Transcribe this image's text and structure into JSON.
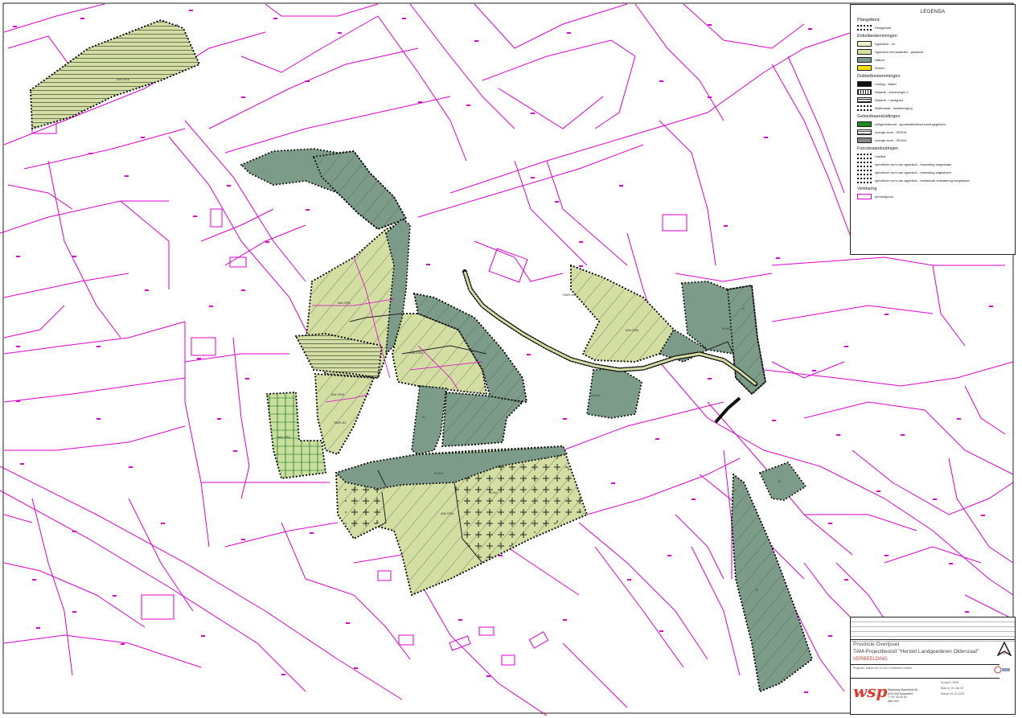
{
  "map": {
    "parcel_color": "#e000d0",
    "agrarisch_color": "#d3dea3",
    "natuur_color": "#7c9b88",
    "labels": {
      "a1": "AW-GRA",
      "a2": "AW-GRA",
      "a3": "AW-GRA",
      "a4": "AW-GRA",
      "a5": "AW-GRA",
      "a6": "AW-GRA",
      "a7": "AW-GRA",
      "r1": "W-AO",
      "r2": "W-AO",
      "r3": "W-AO",
      "r4": "W-AO",
      "r5": "SWR-AO",
      "r6": "SWR-A2",
      "n1": "N",
      "n2": "N",
      "n3": "N",
      "n4": "N"
    }
  },
  "legend": {
    "title": "LEGENDA",
    "plangebied_header": "Plangebied",
    "plangebied": "Plangebied",
    "enkel_header": "Enkelbestemmingen",
    "enkel": [
      "Agrarisch - 1a",
      "Agrarisch met waarden - grasland",
      "Natuur",
      "Wonen"
    ],
    "dubbel_header": "Dubbelbestemmingen",
    "dubbel": [
      "Leiding - Water",
      "Waarde - Archeologie 2",
      "Waarde - Landgoed",
      "Waterstaat - Waterberging"
    ],
    "gebied_header": "Gebiedsaanduidingen",
    "gebied": [
      "veiligheidszone - grondwaterbeschermingsgebied",
      "overige zone - IPZ076",
      "overige zone - IPZ024"
    ],
    "functie_header": "Functieaanduidingen",
    "functie": [
      "Voetbal",
      "specifieke vorm van agrarisch - beweiding toegestaan",
      "specifieke vorm van agrarisch - beweiding uitgesloten",
      "specifieke vorm van agrarisch - bestaande ontwatering toegestaan"
    ],
    "verklaring_header": "Verklaring",
    "verklaring": [
      "perceelgrens"
    ]
  },
  "titleblock": {
    "client": "Provincie Overijssel",
    "project": "TAM-Projectbesluit \"Herstel Landgoederen Oldenzaal\"",
    "subject": "VERBEELDING",
    "company": "wsp",
    "address": [
      "Stadsweg Maastricht 50",
      "6229 DM Maastricht",
      "T +31 43 00 00",
      "wsp.com"
    ],
    "meta": "Projectnr.   Datum 05-12-2024   Getekend   Gezien",
    "scale_info": [
      "Schaal 1:2500",
      "Blad nr. 01 van 02",
      "Datum 05-12-2024"
    ]
  }
}
